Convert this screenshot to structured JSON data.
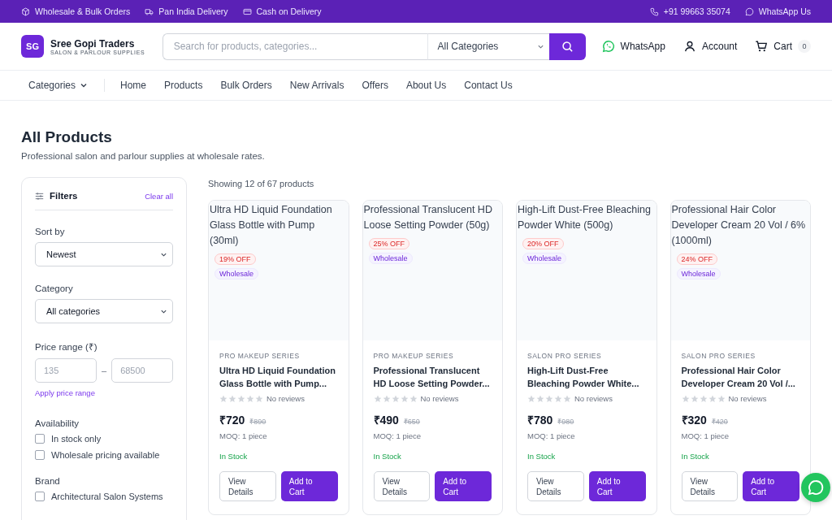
{
  "topbar": {
    "left": [
      "Wholesale & Bulk Orders",
      "Pan India Delivery",
      "Cash on Delivery"
    ],
    "phone": "+91 99663 35074",
    "whatsapp": "WhatsApp Us"
  },
  "header": {
    "logo_mark": "SG",
    "brand": "Sree Gopi Traders",
    "tagline": "SALON & PARLOUR SUPPLIES",
    "search": {
      "placeholder": "Search for products, categories..."
    },
    "category_select": "All Categories",
    "whatsapp": "WhatsApp",
    "account": "Account",
    "cart": "Cart",
    "cart_count": "0"
  },
  "nav": {
    "categories": "Categories",
    "links": [
      "Home",
      "Products",
      "Bulk Orders",
      "New Arrivals",
      "Offers",
      "About Us",
      "Contact Us"
    ]
  },
  "page": {
    "title": "All Products",
    "subtitle": "Professional salon and parlour supplies at wholesale rates."
  },
  "filters": {
    "title": "Filters",
    "clear": "Clear all",
    "sort_label": "Sort by",
    "sort_value": "Newest",
    "category_label": "Category",
    "category_value": "All categories",
    "price_label": "Price range (₹)",
    "price_min": {
      "placeholder": "135"
    },
    "price_max": {
      "placeholder": "68500"
    },
    "price_sep": "–",
    "apply": "Apply price range",
    "availability_label": "Availability",
    "availability": [
      {
        "label": "In stock only",
        "checked": false
      },
      {
        "label": "Wholesale pricing available",
        "checked": false
      }
    ],
    "brand_label": "Brand",
    "brands": [
      {
        "label": "Architectural Salon Systems",
        "checked": false
      }
    ]
  },
  "results": {
    "count": "Showing 12 of 67 products"
  },
  "products": [
    {
      "image_alt": "Ultra HD Liquid Foundation Glass Bottle with Pump (30ml)",
      "discount": "19% OFF",
      "tag": "Wholesale",
      "series": "PRO MAKEUP SERIES",
      "name": "Ultra HD Liquid Foundation Glass Bottle with Pump...",
      "stars": 0,
      "reviews": "No reviews",
      "price": "₹720",
      "old_price": "₹890",
      "moq": "MOQ: 1 piece",
      "stock": "In Stock",
      "view": "View Details",
      "add": "Add to Cart"
    },
    {
      "image_alt": "Professional Translucent HD Loose Setting Powder (50g)",
      "discount": "25% OFF",
      "tag": "Wholesale",
      "series": "PRO MAKEUP SERIES",
      "name": "Professional Translucent HD Loose Setting Powder...",
      "stars": 0,
      "reviews": "No reviews",
      "price": "₹490",
      "old_price": "₹650",
      "moq": "MOQ: 1 piece",
      "stock": "In Stock",
      "view": "View Details",
      "add": "Add to Cart"
    },
    {
      "image_alt": "High-Lift Dust-Free Bleaching Powder White (500g)",
      "discount": "20% OFF",
      "tag": "Wholesale",
      "series": "SALON PRO SERIES",
      "name": "High-Lift Dust-Free Bleaching Powder White...",
      "stars": 0,
      "reviews": "No reviews",
      "price": "₹780",
      "old_price": "₹980",
      "moq": "MOQ: 1 piece",
      "stock": "In Stock",
      "view": "View Details",
      "add": "Add to Cart"
    },
    {
      "image_alt": "Professional Hair Color Developer Cream 20 Vol / 6% (1000ml)",
      "discount": "24% OFF",
      "tag": "Wholesale",
      "series": "SALON PRO SERIES",
      "name": "Professional Hair Color Developer Cream 20 Vol /...",
      "stars": 0,
      "reviews": "No reviews",
      "price": "₹320",
      "old_price": "₹420",
      "moq": "MOQ: 1 piece",
      "stock": "In Stock",
      "view": "View Details",
      "add": "Add to Cart"
    }
  ]
}
